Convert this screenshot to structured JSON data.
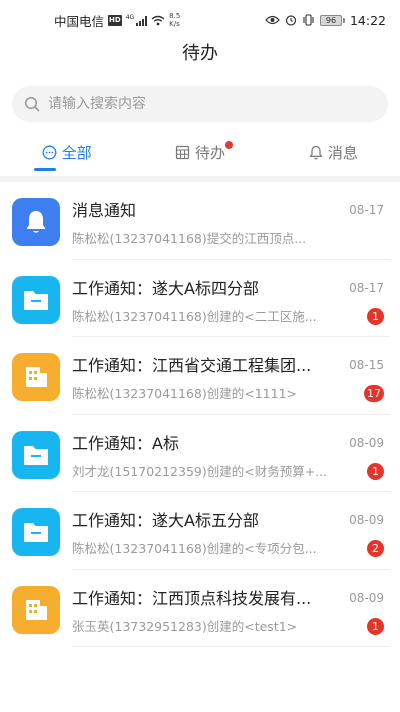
{
  "status_bar": {
    "carrier": "中国电信",
    "hd": "HD",
    "signal": "4G",
    "speed_value": "8.5",
    "speed_unit": "K/s",
    "battery": "96",
    "time": "14:22"
  },
  "header": {
    "title": "待办"
  },
  "search": {
    "placeholder": "请输入搜索内容"
  },
  "tabs": [
    {
      "label": "全部",
      "icon": "dots-circle-icon",
      "active": true
    },
    {
      "label": "待办",
      "icon": "calendar-icon",
      "active": false,
      "has_dot": true
    },
    {
      "label": "消息",
      "icon": "bell-icon",
      "active": false
    }
  ],
  "colors": {
    "accent": "#1f7fe8",
    "badge": "#e5342a",
    "icon_blue": "#3d7ef0",
    "icon_cyan": "#18b6f0",
    "icon_orange": "#f6ad2d"
  },
  "items": [
    {
      "icon": "bell-icon",
      "color": "blue",
      "title": "消息通知",
      "date": "08-17",
      "subtitle": "陈松松(13237041168)提交的江西顶点...",
      "badge": ""
    },
    {
      "icon": "folder-icon",
      "color": "cyan",
      "title": "工作通知：遂大A标四分部",
      "date": "08-17",
      "subtitle": "陈松松(13237041168)创建的<二工区施...",
      "badge": "1"
    },
    {
      "icon": "building-icon",
      "color": "orange",
      "title": "工作通知：江西省交通工程集团...",
      "date": "08-15",
      "subtitle": "陈松松(13237041168)创建的<1111>",
      "badge": "17"
    },
    {
      "icon": "folder-icon",
      "color": "cyan",
      "title": "工作通知：A标",
      "date": "08-09",
      "subtitle": "刘才龙(15170212359)创建的<财务预算+...",
      "badge": "1"
    },
    {
      "icon": "folder-icon",
      "color": "cyan",
      "title": "工作通知：遂大A标五分部",
      "date": "08-09",
      "subtitle": "陈松松(13237041168)创建的<专项分包...",
      "badge": "2"
    },
    {
      "icon": "building-icon",
      "color": "orange",
      "title": "工作通知：江西顶点科技发展有...",
      "date": "08-09",
      "subtitle": "张玉英(13732951283)创建的<test1>",
      "badge": "1"
    }
  ]
}
